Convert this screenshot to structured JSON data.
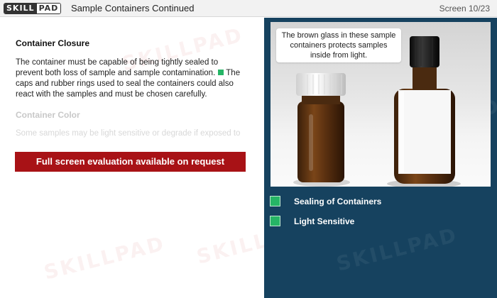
{
  "header": {
    "logo_left": "SKILL",
    "logo_right": "PAD",
    "title": "Sample Containers Continued",
    "screen": "Screen 10/23"
  },
  "content": {
    "closure_heading": "Container Closure",
    "closure_text": "The container must be capable of being tightly sealed to prevent both loss of sample and sample contamination.",
    "closure_text2": "The caps and rubber rings used to seal the containers could also react with the samples and must be chosen carefully.",
    "color_heading": "Container Color",
    "color_text": "Some samples may be light sensitive or degrade if exposed to",
    "eval_button": "Full screen evaluation available on request",
    "watermark": "SKILLPAD"
  },
  "image": {
    "callout": "The brown glass in these sample containers protects samples inside from light."
  },
  "options": [
    {
      "label": "Sealing of Containers"
    },
    {
      "label": "Light Sensitive"
    }
  ],
  "colors": {
    "panel": "#16425f",
    "accent_red": "#a81216",
    "accent_green": "#26b566"
  }
}
